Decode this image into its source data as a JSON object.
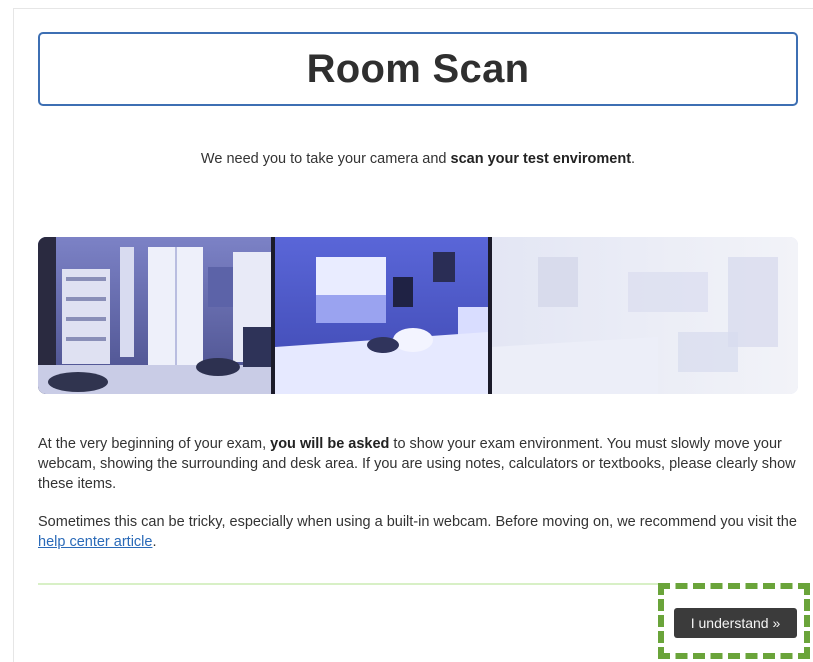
{
  "page": {
    "title": "Room Scan",
    "intro_prefix": "We need you to take your camera and ",
    "intro_bold": "scan your test enviroment",
    "intro_suffix": "."
  },
  "scan_image": {
    "icon": "room-panorama-image"
  },
  "instructions": {
    "p1_prefix": "At the very beginning of your exam, ",
    "p1_bold": "you will be asked",
    "p1_suffix": " to show your exam environment. You must slowly move your webcam, showing the surrounding and desk area. If you are using notes, calculators or textbooks, please clearly show these items.",
    "p2_prefix": "Sometimes this can be tricky, especially when using a built-in webcam. Before moving on, we recommend you visit the ",
    "p2_link": "help center article",
    "p2_suffix": "."
  },
  "actions": {
    "understand_label": "I understand »"
  },
  "colors": {
    "title_border": "#3d6fb3",
    "button_bg": "#3b3b3b",
    "highlight": "#6aa43a",
    "link": "#2a6ab8"
  }
}
